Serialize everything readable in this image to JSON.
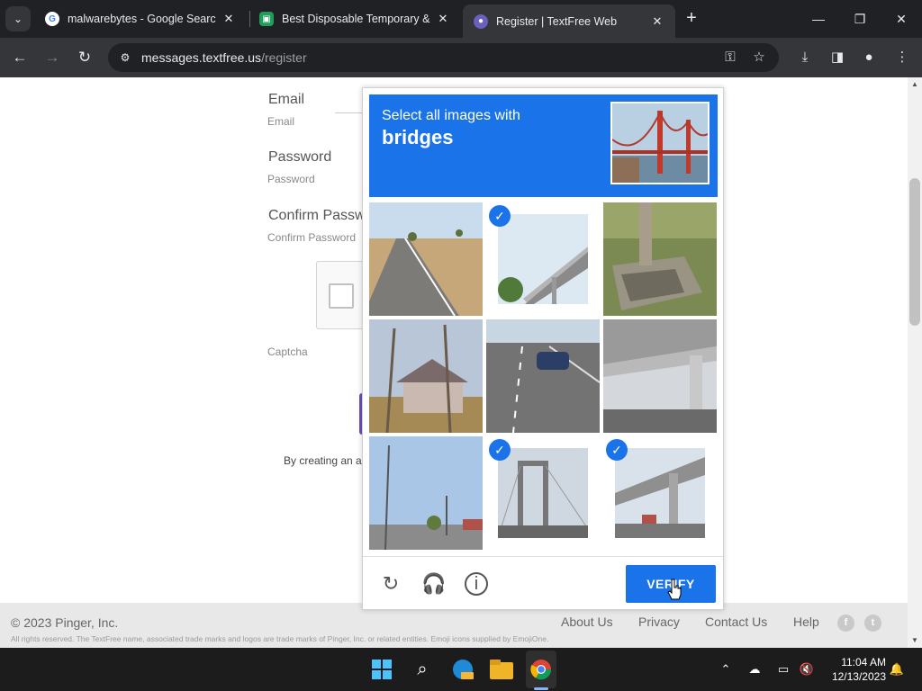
{
  "browser": {
    "tabs": [
      {
        "title": "malwarebytes - Google Search",
        "close": "✕"
      },
      {
        "title": "Best Disposable Temporary & F",
        "close": "✕"
      },
      {
        "title": "Register | TextFree Web",
        "close": "✕"
      }
    ],
    "new_tab": "+",
    "window_controls": {
      "minimize": "—",
      "restore": "❐",
      "close": "✕"
    },
    "url_host": "messages.textfree.us",
    "url_path": "/register"
  },
  "form": {
    "email_label": "Email",
    "email_sub": "Email",
    "password_label": "Password",
    "password_sub": "Password",
    "confirm_label": "Confirm Passw",
    "confirm_sub": "Confirm Password",
    "captcha_label": "Captcha",
    "terms_text": "By creating an a"
  },
  "challenge": {
    "line1": "Select all images with",
    "line2": "bridges",
    "tiles": [
      {
        "name": "road-field",
        "selected": false
      },
      {
        "name": "highway-overpass",
        "selected": true
      },
      {
        "name": "stone-ruin",
        "selected": false
      },
      {
        "name": "house-trees",
        "selected": false
      },
      {
        "name": "highway-car",
        "selected": false
      },
      {
        "name": "under-overpass",
        "selected": false
      },
      {
        "name": "utility-poles-road",
        "selected": false
      },
      {
        "name": "suspension-bridge",
        "selected": true
      },
      {
        "name": "overpass-side",
        "selected": true
      }
    ],
    "verify_label": "VERIFY"
  },
  "footer": {
    "copyright": "© 2023 Pinger, Inc.",
    "legal": "All rights reserved. The TextFree name, associated trade marks and logos are trade marks of Pinger, Inc. or related entities. Emoji icons supplied by EmojiOne.",
    "links": [
      "About Us",
      "Privacy",
      "Contact Us",
      "Help"
    ]
  },
  "taskbar": {
    "time": "11:04 AM",
    "date": "12/13/2023"
  },
  "colors": {
    "accent": "#1a73e8",
    "chrome_dark": "#202124",
    "chrome_toolbar": "#35363a",
    "taskbar": "#1c1c1c"
  }
}
